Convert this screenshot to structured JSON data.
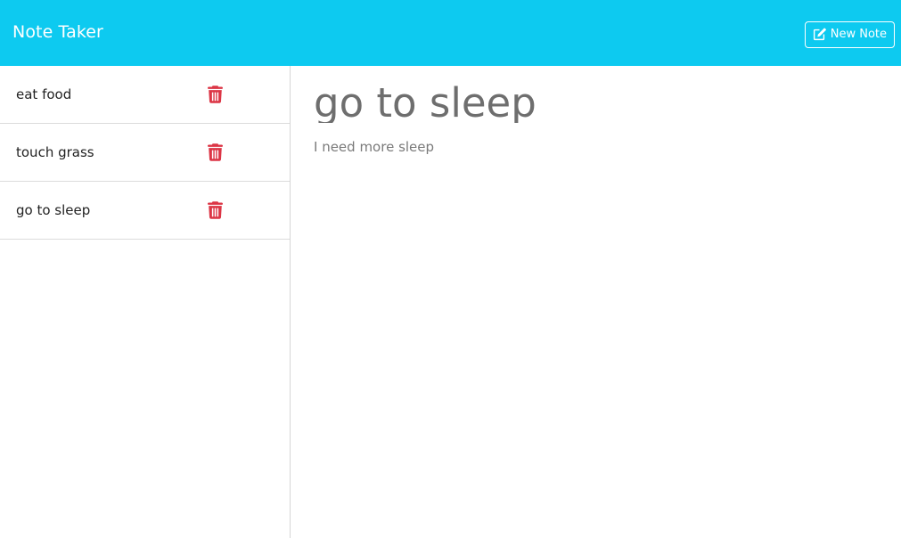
{
  "navbar": {
    "brand": "Note Taker",
    "new_note_label": "New Note",
    "background_color": "#0dcaf0",
    "new_note_icon": "pen-to-square-icon"
  },
  "sidebar": {
    "notes": [
      {
        "title": "eat food",
        "delete_icon": "trash-icon"
      },
      {
        "title": "touch grass",
        "delete_icon": "trash-icon"
      },
      {
        "title": "go to sleep",
        "delete_icon": "trash-icon"
      }
    ],
    "delete_icon_color": "#dc3545"
  },
  "editor": {
    "title": "go to sleep",
    "body": "I need more sleep"
  }
}
